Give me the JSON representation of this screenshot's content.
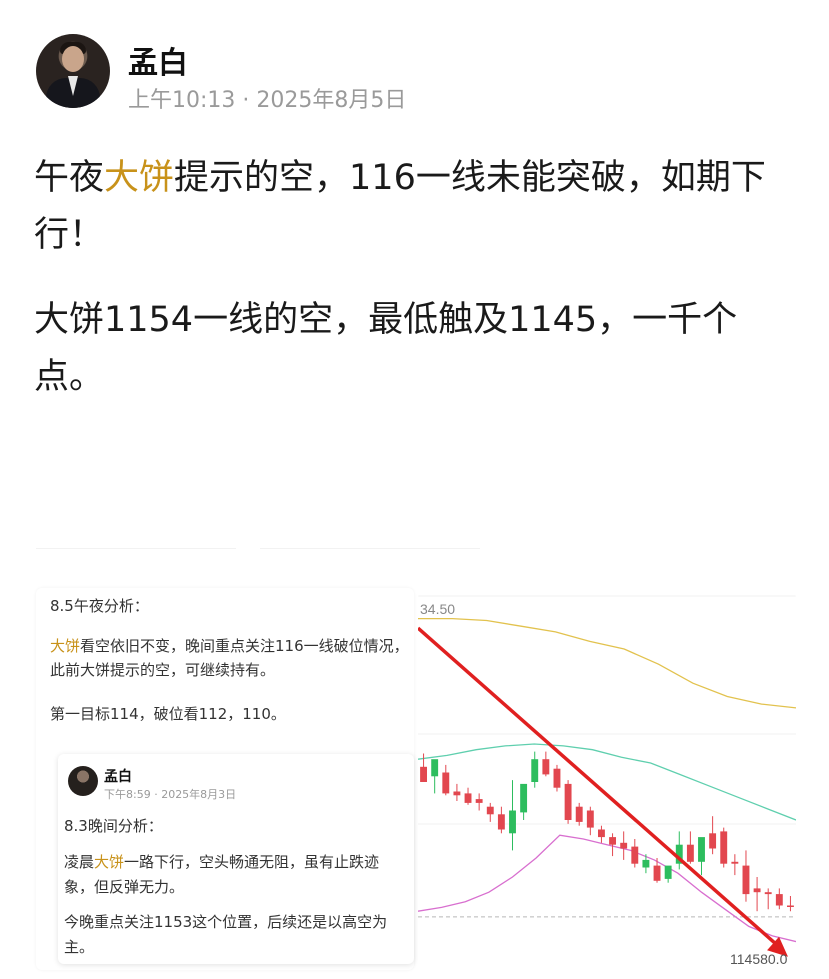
{
  "post": {
    "author": "孟白",
    "time": "上午10:13 · 2025年8月5日",
    "p1": {
      "pre": "午夜",
      "hl": "大饼",
      "post": "提示的空，116一线未能突破，如期下行！"
    },
    "p2": "大饼1154一线的空，最低触及1145，一千个点。"
  },
  "card": {
    "title": "8.5午夜分析：",
    "p1": {
      "hl": "大饼",
      "rest": "看空依旧不变，晚间重点关注116一线破位情况，此前大饼提示的空，可继续持有。"
    },
    "p2": "第一目标114，破位看112，110。",
    "quote": {
      "author": "孟白",
      "time": "下午8:59 · 2025年8月3日",
      "title": "8.3晚间分析：",
      "p1": {
        "pre": "凌晨",
        "hl": "大饼",
        "post": "一路下行，空头畅通无阻，虽有止跌迹象，但反弹无力。"
      },
      "p2": "今晚重点关注1153这个位置，后续还是以高空为主。"
    }
  },
  "chart_data": {
    "type": "candlestick",
    "top_label": "34.50",
    "price_label": "114580.0",
    "colors": {
      "up": "#2dbd5e",
      "down": "#e2474f",
      "arrow": "#e02020",
      "upper_band": "#e2c24e",
      "middle_band": "#5fcfae",
      "lower_band": "#d86fcf",
      "reference": "#b8b8b8"
    },
    "candles": [
      {
        "o": 0.46,
        "h": 0.425,
        "c": 0.5,
        "l": 0.5
      },
      {
        "o": 0.485,
        "h": 0.47,
        "c": 0.44,
        "l": 0.53
      },
      {
        "o": 0.475,
        "h": 0.455,
        "c": 0.53,
        "l": 0.535
      },
      {
        "o": 0.525,
        "h": 0.505,
        "c": 0.535,
        "l": 0.55
      },
      {
        "o": 0.53,
        "h": 0.515,
        "c": 0.555,
        "l": 0.56
      },
      {
        "o": 0.545,
        "h": 0.53,
        "c": 0.555,
        "l": 0.575
      },
      {
        "o": 0.565,
        "h": 0.555,
        "c": 0.585,
        "l": 0.605
      },
      {
        "o": 0.585,
        "h": 0.565,
        "c": 0.625,
        "l": 0.635
      },
      {
        "o": 0.635,
        "h": 0.495,
        "c": 0.575,
        "l": 0.68
      },
      {
        "o": 0.58,
        "h": 0.54,
        "c": 0.505,
        "l": 0.6
      },
      {
        "o": 0.5,
        "h": 0.42,
        "c": 0.44,
        "l": 0.515
      },
      {
        "o": 0.44,
        "h": 0.42,
        "c": 0.48,
        "l": 0.485
      },
      {
        "o": 0.465,
        "h": 0.455,
        "c": 0.515,
        "l": 0.525
      },
      {
        "o": 0.505,
        "h": 0.495,
        "c": 0.6,
        "l": 0.61
      },
      {
        "o": 0.565,
        "h": 0.555,
        "c": 0.605,
        "l": 0.615
      },
      {
        "o": 0.575,
        "h": 0.565,
        "c": 0.62,
        "l": 0.64
      },
      {
        "o": 0.625,
        "h": 0.615,
        "c": 0.645,
        "l": 0.66
      },
      {
        "o": 0.645,
        "h": 0.635,
        "c": 0.665,
        "l": 0.695
      },
      {
        "o": 0.66,
        "h": 0.63,
        "c": 0.675,
        "l": 0.705
      },
      {
        "o": 0.67,
        "h": 0.65,
        "c": 0.715,
        "l": 0.725
      },
      {
        "o": 0.725,
        "h": 0.69,
        "c": 0.705,
        "l": 0.74
      },
      {
        "o": 0.72,
        "h": 0.7,
        "c": 0.76,
        "l": 0.765
      },
      {
        "o": 0.755,
        "h": 0.73,
        "c": 0.72,
        "l": 0.765
      },
      {
        "o": 0.715,
        "h": 0.63,
        "c": 0.665,
        "l": 0.73
      },
      {
        "o": 0.665,
        "h": 0.63,
        "c": 0.71,
        "l": 0.715
      },
      {
        "o": 0.71,
        "h": 0.665,
        "c": 0.645,
        "l": 0.745
      },
      {
        "o": 0.635,
        "h": 0.59,
        "c": 0.675,
        "l": 0.69
      },
      {
        "o": 0.63,
        "h": 0.62,
        "c": 0.715,
        "l": 0.725
      },
      {
        "o": 0.71,
        "h": 0.69,
        "c": 0.715,
        "l": 0.745
      },
      {
        "o": 0.72,
        "h": 0.68,
        "c": 0.795,
        "l": 0.815
      },
      {
        "o": 0.78,
        "h": 0.75,
        "c": 0.79,
        "l": 0.84
      },
      {
        "o": 0.79,
        "h": 0.78,
        "c": 0.795,
        "l": 0.835
      },
      {
        "o": 0.795,
        "h": 0.78,
        "c": 0.825,
        "l": 0.835
      },
      {
        "o": 0.825,
        "h": 0.8,
        "c": 0.825,
        "l": 0.84
      }
    ],
    "upper_band": [
      0.07,
      0.07,
      0.075,
      0.09,
      0.105,
      0.13,
      0.15,
      0.19,
      0.24,
      0.275,
      0.295,
      0.305
    ],
    "middle_band": [
      0.44,
      0.43,
      0.415,
      0.405,
      0.4,
      0.405,
      0.415,
      0.435,
      0.45,
      0.48,
      0.51,
      0.54,
      0.57,
      0.6
    ],
    "lower_band": [
      0.84,
      0.83,
      0.815,
      0.79,
      0.75,
      0.7,
      0.64,
      0.65,
      0.665,
      0.68,
      0.705,
      0.74,
      0.79,
      0.835,
      0.88,
      0.905,
      0.92
    ]
  }
}
